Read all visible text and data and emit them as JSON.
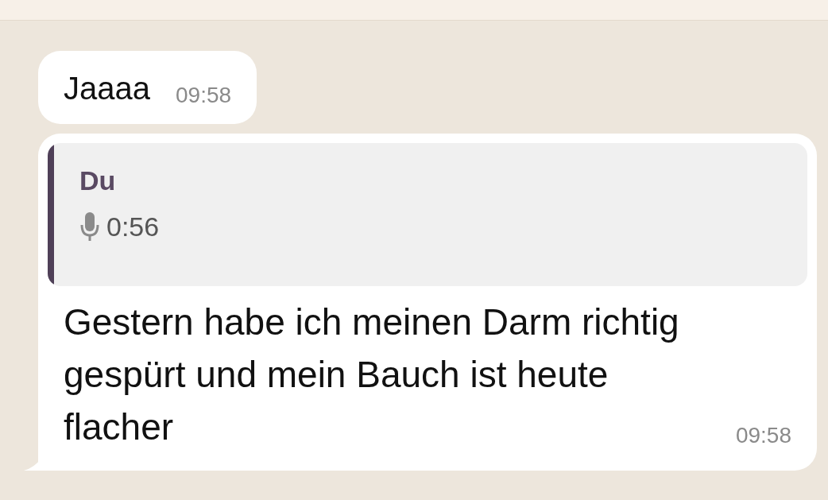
{
  "messages": [
    {
      "kind": "text",
      "tail": false,
      "text": "Jaaaa",
      "time": "09:58"
    },
    {
      "kind": "reply",
      "tail": true,
      "quote": {
        "author": "Du",
        "duration": "0:56"
      },
      "text": "Gestern habe ich meinen Darm richtig gespürt und mein Bauch ist heute flacher",
      "time": "09:58"
    }
  ]
}
